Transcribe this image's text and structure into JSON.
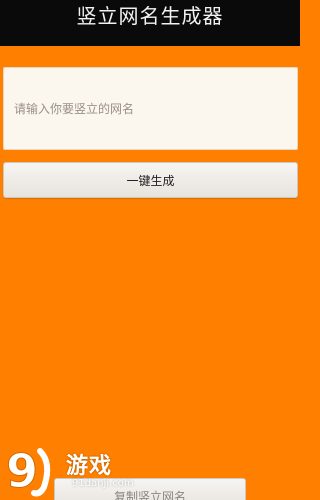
{
  "app_bar": {
    "title": "竖立网名生成器"
  },
  "name_input": {
    "placeholder": "请输入你要竖立的网名",
    "value": ""
  },
  "generate_button": {
    "label": "一键生成"
  },
  "copy_button": {
    "label": "复制竖立网名"
  },
  "watermark": {
    "logo_text": "9",
    "brand": "游戏",
    "domain": "91danji.com"
  },
  "colors": {
    "background": "#ff8000",
    "app_bar": "#0a0a0a",
    "input_background": "#fbf7ef"
  }
}
